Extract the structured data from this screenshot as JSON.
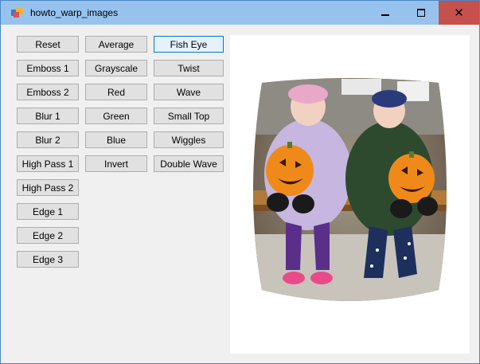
{
  "window": {
    "title": "howto_warp_images",
    "minimize_glyph": "minimize-icon",
    "maximize_glyph": "maximize-icon",
    "close_glyph": "✕"
  },
  "buttons": {
    "col1": [
      "Reset",
      "Emboss 1",
      "Emboss 2",
      "Blur 1",
      "Blur 2",
      "High Pass 1",
      "High Pass 2",
      "Edge 1",
      "Edge 2",
      "Edge 3"
    ],
    "col2": [
      "Average",
      "Grayscale",
      "Red",
      "Green",
      "Blue",
      "Invert"
    ],
    "col3": [
      "Fish Eye",
      "Twist",
      "Wave",
      "Small Top",
      "Wiggles",
      "Double Wave"
    ]
  },
  "colors": {
    "titlebar": "#97c2ee",
    "close_hover": "#c6504c",
    "focus_border": "#0078d7"
  },
  "image": {
    "icon": "warped-photo-fish-eye"
  }
}
